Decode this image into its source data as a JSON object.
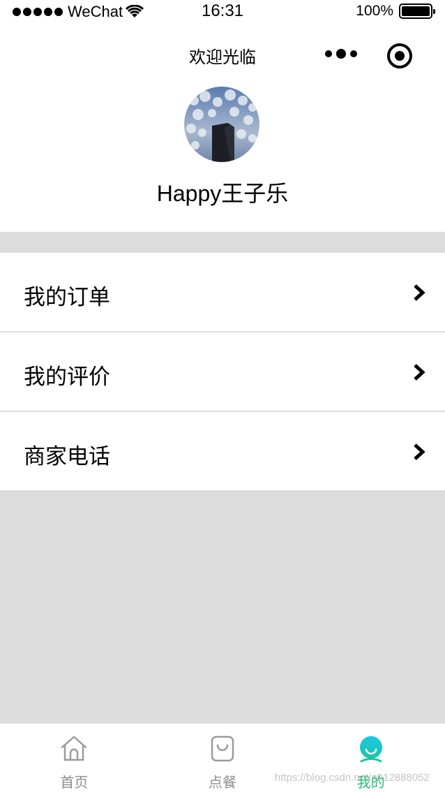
{
  "status_bar": {
    "carrier": "WeChat",
    "time": "16:31",
    "battery": "100%"
  },
  "nav": {
    "title": "欢迎光临"
  },
  "profile": {
    "username": "Happy王子乐"
  },
  "menu": [
    {
      "label": "我的订单"
    },
    {
      "label": "我的评价"
    },
    {
      "label": "商家电话"
    }
  ],
  "tabs": [
    {
      "label": "首页",
      "icon": "home-icon",
      "active": false
    },
    {
      "label": "点餐",
      "icon": "bag-icon",
      "active": false
    },
    {
      "label": "我的",
      "icon": "profile-icon",
      "active": true
    }
  ],
  "colors": {
    "active": "#1fbf7a",
    "inactive": "#8c8c8c",
    "background": "#dcdcdc"
  },
  "watermark": "https://blog.csdn.net/u012888052"
}
